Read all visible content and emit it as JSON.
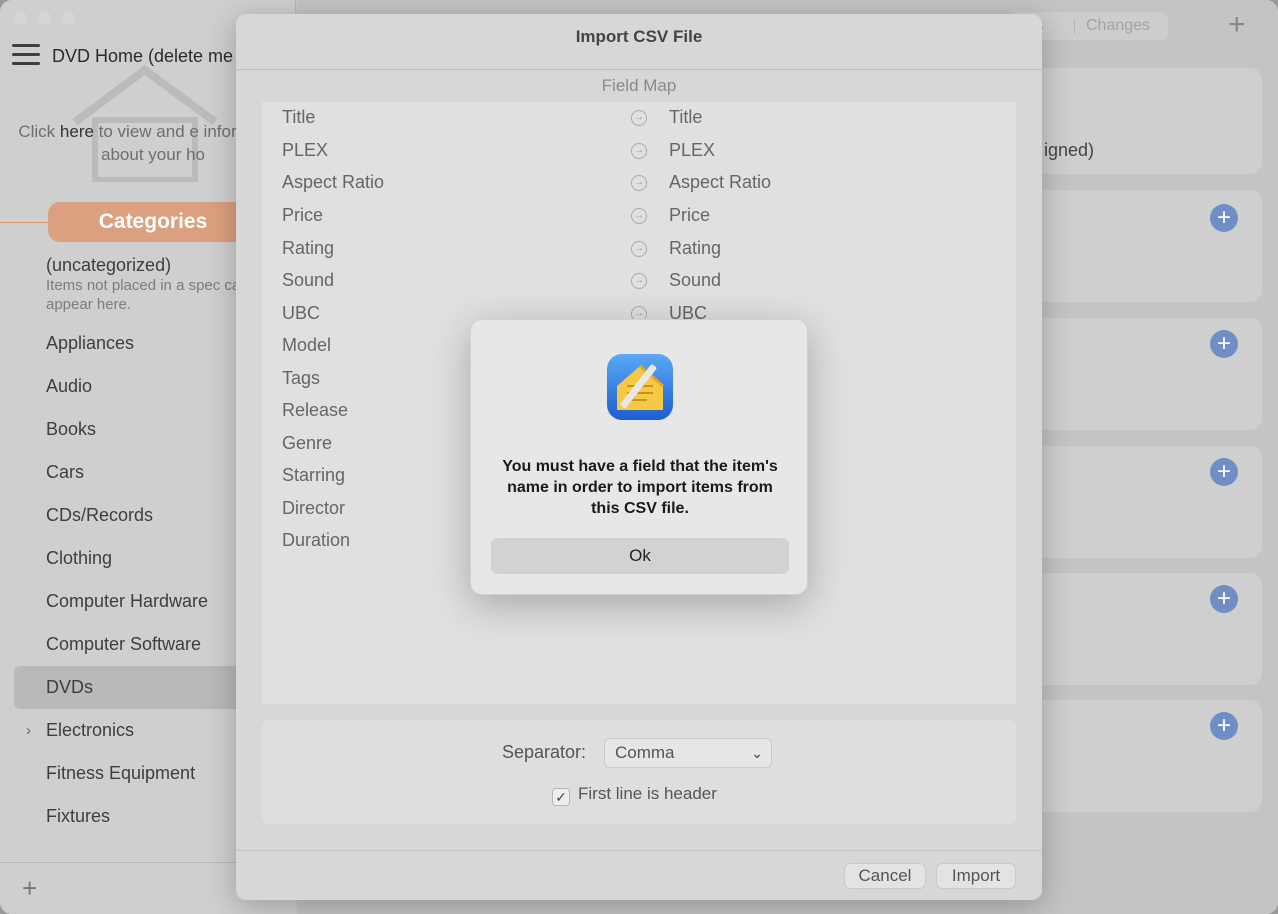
{
  "window": {
    "title": "DVD Home (delete me",
    "home_info_prefix": "Click ",
    "home_info_link": "here",
    "home_info_suffix": " to view and e information about your ho"
  },
  "sidebar": {
    "categories_label": "Categories",
    "uncategorized_title": "(uncategorized)",
    "uncategorized_desc": "Items not placed in a spec category appear here.",
    "items": [
      {
        "label": "Appliances"
      },
      {
        "label": "Audio"
      },
      {
        "label": "Books"
      },
      {
        "label": "Cars"
      },
      {
        "label": "CDs/Records"
      },
      {
        "label": "Clothing"
      },
      {
        "label": "Computer Hardware"
      },
      {
        "label": "Computer Software"
      },
      {
        "label": "DVDs"
      },
      {
        "label": "Electronics"
      },
      {
        "label": "Fitness Equipment"
      },
      {
        "label": "Fixtures"
      }
    ],
    "selected": "DVDs"
  },
  "content": {
    "segment_a": "rs",
    "segment_b": "Changes",
    "card_text": "igned)"
  },
  "sheet": {
    "title": "Import CSV File",
    "field_map_label": "Field Map",
    "rows": [
      {
        "source": "Title",
        "target": "Title"
      },
      {
        "source": "PLEX",
        "target": "PLEX"
      },
      {
        "source": "Aspect Ratio",
        "target": "Aspect Ratio"
      },
      {
        "source": "Price",
        "target": "Price"
      },
      {
        "source": "Rating",
        "target": "Rating"
      },
      {
        "source": "Sound",
        "target": "Sound"
      },
      {
        "source": "UBC",
        "target": "UBC"
      },
      {
        "source": "Model",
        "target": ""
      },
      {
        "source": "Tags",
        "target": ""
      },
      {
        "source": "Release",
        "target": ""
      },
      {
        "source": "Genre",
        "target": ""
      },
      {
        "source": "Starring",
        "target": ""
      },
      {
        "source": "Director",
        "target": ""
      },
      {
        "source": "Duration",
        "target": ""
      }
    ],
    "separator_label": "Separator:",
    "separator_value": "Comma",
    "first_line_header_label": "First line is header",
    "first_line_header_checked": true,
    "cancel_label": "Cancel",
    "import_label": "Import"
  },
  "alert": {
    "message": "You must have a field that the item's name in order to import items from this CSV file.",
    "ok_label": "Ok"
  },
  "colors": {
    "accent_categories": "#dba07f",
    "add_button": "#6f8ec6"
  }
}
